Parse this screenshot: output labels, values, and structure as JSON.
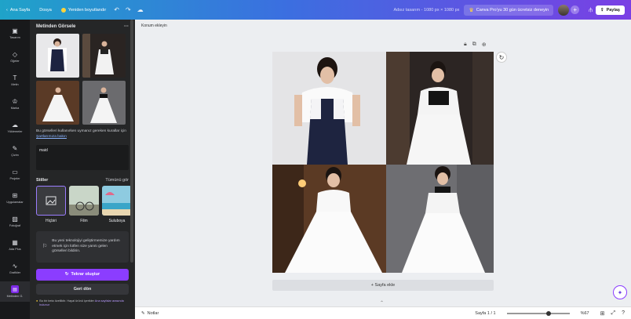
{
  "topbar": {
    "home": "Ana Sayfa",
    "file": "Dosya",
    "resize": "Yeniden boyutlandır",
    "size_label": "Adsız tasarım - 1080 px × 1080 px",
    "pro": "Canva Pro'yu 30 gün ücretsiz deneyin",
    "share": "Paylaş"
  },
  "rail": [
    {
      "label": "Tasarım",
      "icon": "▣"
    },
    {
      "label": "Öğeler",
      "icon": "◇"
    },
    {
      "label": "Metin",
      "icon": "T"
    },
    {
      "label": "Marka",
      "icon": "♔"
    },
    {
      "label": "Yüklemeler",
      "icon": "☁"
    },
    {
      "label": "Çizim",
      "icon": "✎"
    },
    {
      "label": "Projeler",
      "icon": "▭"
    },
    {
      "label": "Uygulamalar",
      "icon": "⊞"
    },
    {
      "label": "Fotoğraf",
      "icon": "▨"
    },
    {
      "label": "Ada Plus",
      "icon": "▦"
    },
    {
      "label": "Grafikler",
      "icon": "∿"
    },
    {
      "label": "Metinden G.",
      "icon": "▤"
    }
  ],
  "panel": {
    "title": "Metinden Görsele",
    "note": "Bu görselleri kullanırken uymanız gereken kurallar için ",
    "note_link": "Şartlarımıza bakın",
    "prompt": "maid",
    "styles_title": "Stiller",
    "styles_all": "Tümünü gör",
    "styles": [
      "Hiçbiri",
      "Film",
      "Suluboya"
    ],
    "info": "Bu yeni teknolojiyi geliştirmemize yardım etmek için lütfen size yanıtı gelen görselleri bildirin.",
    "generate": "Tekrar oluştur",
    "back": "Geri dön",
    "footnote": "Bu bir beta özelliktir. Hayal ürünü içerikler ",
    "footnote_link": "Ana sayfalar arasında bulunur"
  },
  "canvas": {
    "page_label": "Konum ekleyin",
    "add_page": "+ Sayfa ekle"
  },
  "bottombar": {
    "notes": "Notlar",
    "page": "Sayfa 1 / 1",
    "zoom": "%67",
    "zoom_fraction": 0.67
  }
}
